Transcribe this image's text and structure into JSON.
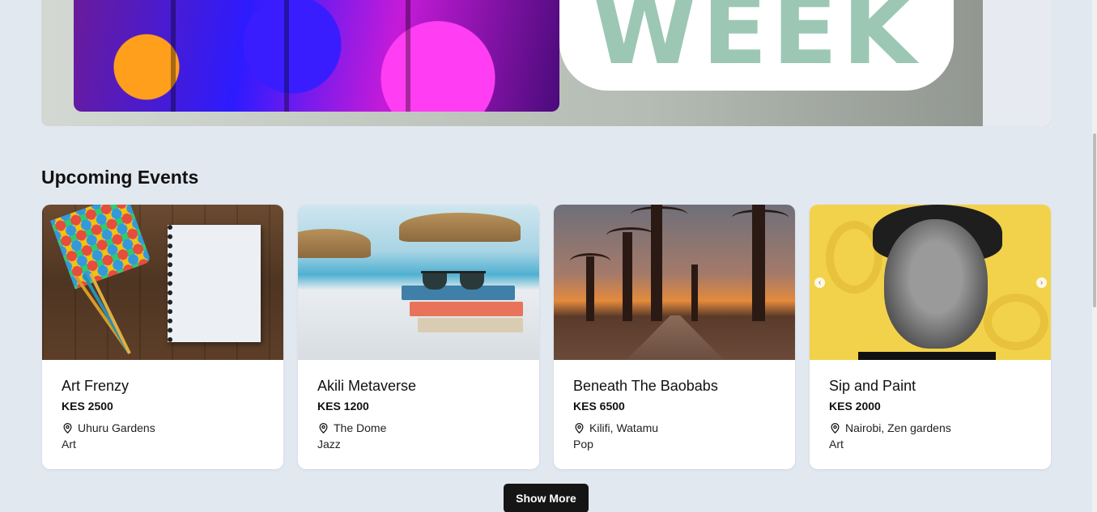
{
  "hero": {
    "word": "WEEK"
  },
  "section": {
    "title": "Upcoming Events"
  },
  "events": [
    {
      "title": "Art Frenzy",
      "price": "KES 2500",
      "location": "Uhuru Gardens",
      "genre": "Art"
    },
    {
      "title": "Akili Metaverse",
      "price": "KES 1200",
      "location": "The Dome",
      "genre": "Jazz"
    },
    {
      "title": "Beneath The Baobabs",
      "price": "KES 6500",
      "location": "Kilifi, Watamu",
      "genre": "Pop"
    },
    {
      "title": "Sip and Paint",
      "price": "KES 2000",
      "location": "Nairobi, Zen gardens",
      "genre": "Art"
    }
  ],
  "carousel": {
    "prev_glyph": "‹",
    "next_glyph": "›"
  },
  "show_more_label": "Show More",
  "colors": {
    "page_bg": "#e2e8f0",
    "card_bg": "#ffffff",
    "button_bg": "#151515"
  }
}
